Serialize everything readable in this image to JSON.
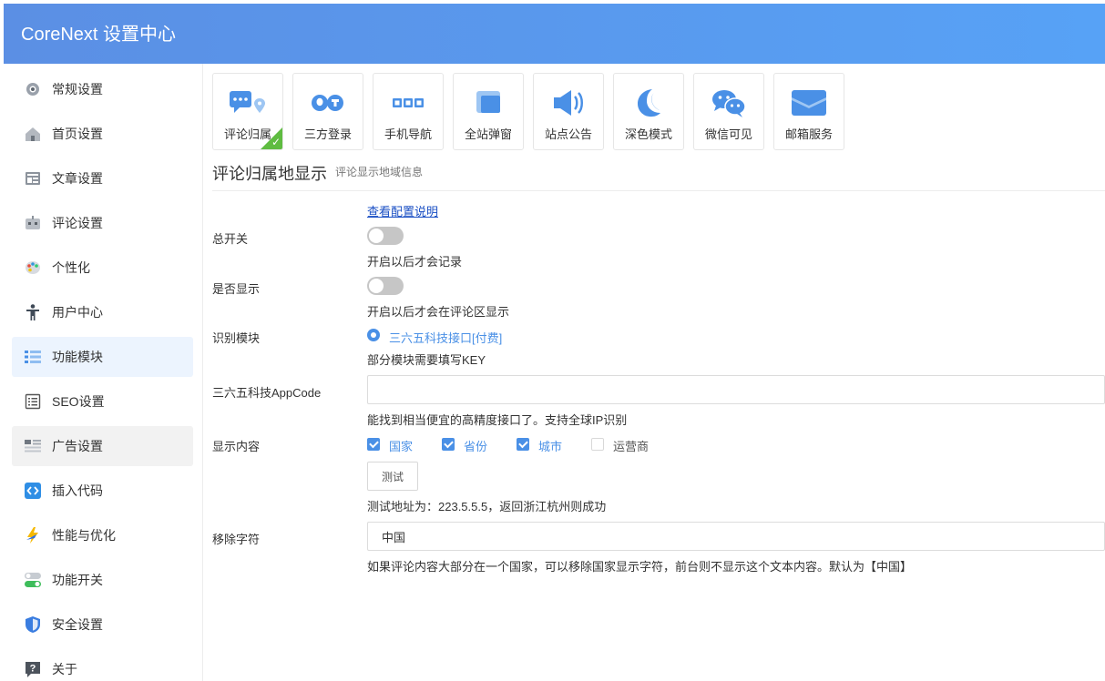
{
  "app": {
    "title": "CoreNext 设置中心"
  },
  "sidebar": {
    "items": [
      {
        "label": "常规设置",
        "icon": "gear-icon"
      },
      {
        "label": "首页设置",
        "icon": "home-icon"
      },
      {
        "label": "文章设置",
        "icon": "article-icon"
      },
      {
        "label": "评论设置",
        "icon": "comment-icon"
      },
      {
        "label": "个性化",
        "icon": "palette-icon"
      },
      {
        "label": "用户中心",
        "icon": "user-icon"
      },
      {
        "label": "功能模块",
        "icon": "module-icon",
        "state": "active"
      },
      {
        "label": "SEO设置",
        "icon": "seo-icon"
      },
      {
        "label": "广告设置",
        "icon": "ad-icon",
        "state": "hover"
      },
      {
        "label": "插入代码",
        "icon": "code-icon"
      },
      {
        "label": "性能与优化",
        "icon": "lightning-icon"
      },
      {
        "label": "功能开关",
        "icon": "toggle-icon"
      },
      {
        "label": "安全设置",
        "icon": "shield-icon"
      },
      {
        "label": "关于",
        "icon": "question-icon"
      }
    ]
  },
  "tabs": [
    {
      "label": "评论归属",
      "icon": "comment-location-icon",
      "selected": true
    },
    {
      "label": "三方登录",
      "icon": "third-party-login-icon"
    },
    {
      "label": "手机导航",
      "icon": "mobile-nav-icon"
    },
    {
      "label": "全站弹窗",
      "icon": "popup-icon"
    },
    {
      "label": "站点公告",
      "icon": "megaphone-icon"
    },
    {
      "label": "深色模式",
      "icon": "moon-icon"
    },
    {
      "label": "微信可见",
      "icon": "wechat-icon"
    },
    {
      "label": "邮箱服务",
      "icon": "mail-icon"
    }
  ],
  "section": {
    "title": "评论归属地显示",
    "subtitle": "评论显示地域信息",
    "doc_link": "查看配置说明"
  },
  "form": {
    "master_switch": {
      "label": "总开关",
      "on": false,
      "help": "开启以后才会记录"
    },
    "show_switch": {
      "label": "是否显示",
      "on": false,
      "help": "开启以后才会在评论区显示"
    },
    "module": {
      "label": "识别模块",
      "option": "三六五科技接口[付费]",
      "help": "部分模块需要填写KEY"
    },
    "appcode": {
      "label": "三六五科技AppCode",
      "value": "",
      "help": "能找到相当便宜的高精度接口了。支持全球IP识别"
    },
    "display": {
      "label": "显示内容",
      "options": [
        {
          "label": "国家",
          "checked": true
        },
        {
          "label": "省份",
          "checked": true
        },
        {
          "label": "城市",
          "checked": true
        },
        {
          "label": "运营商",
          "checked": false
        }
      ],
      "test_button": "测试",
      "help": "测试地址为：223.5.5.5，返回浙江杭州则成功"
    },
    "remove_chars": {
      "label": "移除字符",
      "value": "中国",
      "help": "如果评论内容大部分在一个国家，可以移除国家显示字符，前台则不显示这个文本内容。默认为【中国】"
    }
  },
  "colors": {
    "header_start": "#5b8fe4",
    "header_end": "#57a2f6",
    "accent": "#4a90e6",
    "active_bg": "#ecf4fe",
    "check_green": "#5fbc41"
  }
}
